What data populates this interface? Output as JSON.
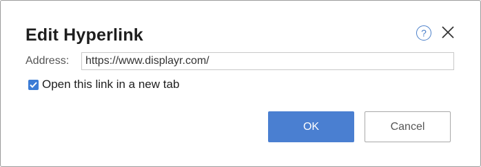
{
  "dialog": {
    "title": "Edit Hyperlink",
    "help_icon": "help-circle-icon",
    "help_glyph": "?",
    "close_icon": "close-icon"
  },
  "address": {
    "label": "Address:",
    "value": "https://www.displayr.com/"
  },
  "new_tab": {
    "label": "Open this link in a new tab",
    "checked": true
  },
  "buttons": {
    "ok_label": "OK",
    "cancel_label": "Cancel"
  },
  "colors": {
    "accent": "#4a7fd1",
    "checkbox": "#3b7bd5"
  }
}
